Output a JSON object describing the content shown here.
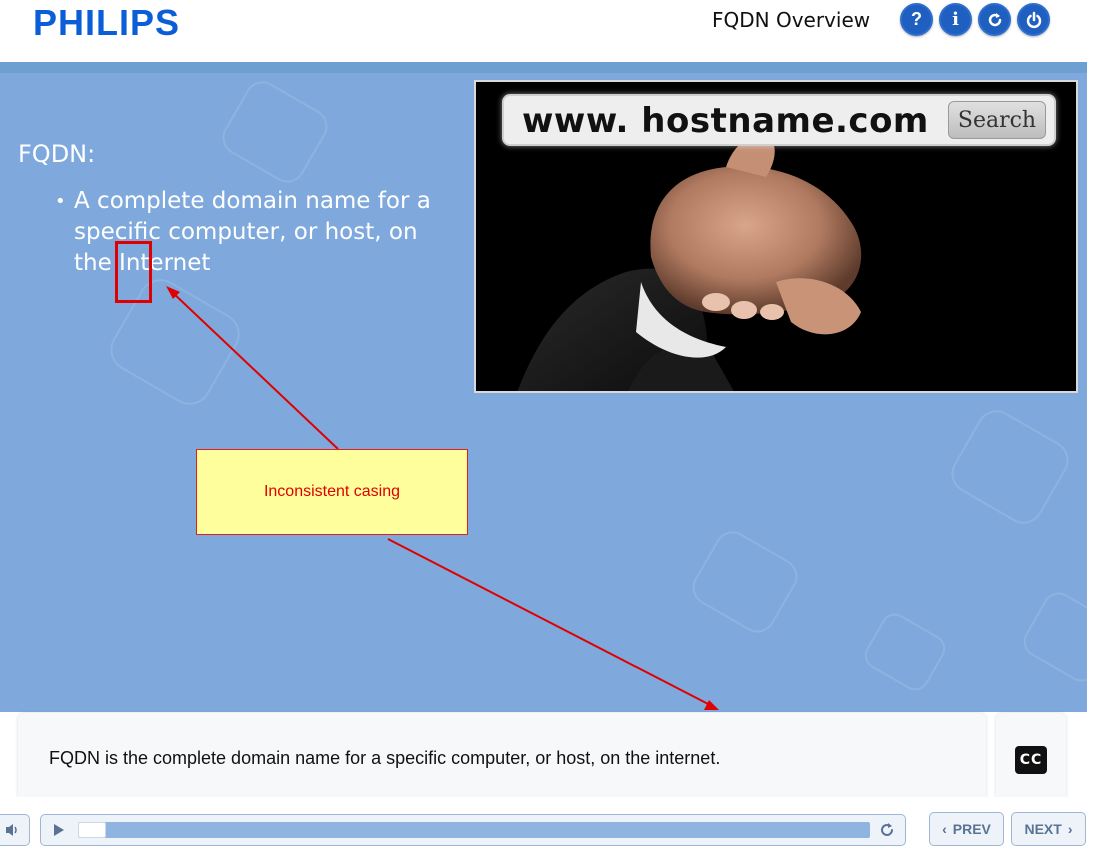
{
  "header": {
    "logo": "PHILIPS",
    "title": "FQDN Overview",
    "buttons": [
      {
        "name": "help",
        "icon": "question-icon",
        "label": "?"
      },
      {
        "name": "info",
        "icon": "info-icon",
        "label": "i"
      },
      {
        "name": "replay",
        "icon": "refresh-icon"
      },
      {
        "name": "exit",
        "icon": "power-icon"
      }
    ],
    "brand_color": "#0b5ed7"
  },
  "slide": {
    "heading": "FQDN:",
    "bullets": [
      "A complete domain name for a specific computer, or host, on the Internet"
    ],
    "image": {
      "url_text": "www. hostname.com",
      "search_label": "Search"
    },
    "background_color": "#7fa9dc"
  },
  "annotation": {
    "callout_text": "Inconsistent casing",
    "callout_color": "#fffe9c",
    "border_color": "#e00000"
  },
  "transcript": {
    "text": "FQDN is the complete domain name for a specific computer, or host, on the internet.",
    "cc_label": "CC"
  },
  "player": {
    "progress": 0.035,
    "prev_label": "PREV",
    "next_label": "NEXT"
  }
}
